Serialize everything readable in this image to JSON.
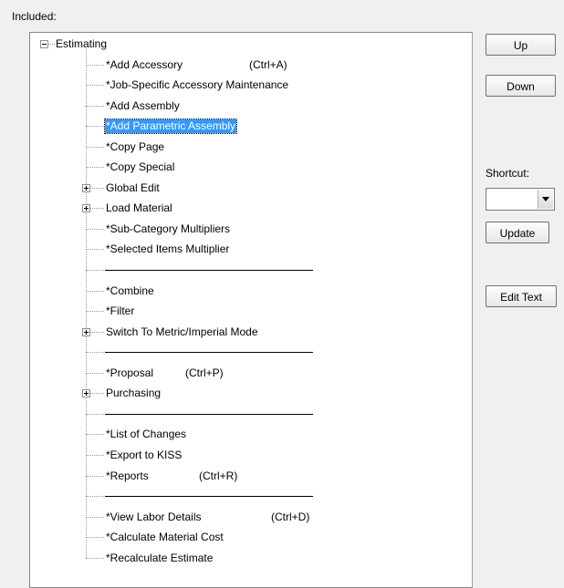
{
  "labels": {
    "included": "Included:",
    "shortcut": "Shortcut:"
  },
  "buttons": {
    "up": "Up",
    "down": "Down",
    "update": "Update",
    "edit_text": "Edit Text"
  },
  "shortcut_combo": {
    "value": ""
  },
  "tree": {
    "root": {
      "label": "Estimating",
      "expanded": true
    },
    "items": [
      {
        "label": "*Add Accessory",
        "shortcut": "(Ctrl+A)",
        "type": "leaf"
      },
      {
        "label": "*Job-Specific Accessory Maintenance",
        "type": "leaf"
      },
      {
        "label": "*Add Assembly",
        "type": "leaf"
      },
      {
        "label": "*Add Parametric Assembly",
        "type": "leaf",
        "selected": true
      },
      {
        "label": "*Copy Page",
        "type": "leaf"
      },
      {
        "label": "*Copy Special",
        "type": "leaf"
      },
      {
        "label": "Global Edit",
        "type": "folder",
        "expanded": false
      },
      {
        "label": "Load Material",
        "type": "folder",
        "expanded": false
      },
      {
        "label": "*Sub-Category Multipliers",
        "type": "leaf"
      },
      {
        "label": "*Selected Items Multiplier",
        "type": "leaf"
      },
      {
        "label": "",
        "type": "separator"
      },
      {
        "label": "*Combine",
        "type": "leaf"
      },
      {
        "label": "*Filter",
        "type": "leaf"
      },
      {
        "label": "Switch To Metric/Imperial Mode",
        "type": "folder",
        "expanded": false
      },
      {
        "label": "",
        "type": "separator"
      },
      {
        "label": "*Proposal",
        "shortcut": "(Ctrl+P)",
        "type": "leaf"
      },
      {
        "label": "Purchasing",
        "type": "folder",
        "expanded": false
      },
      {
        "label": "",
        "type": "separator"
      },
      {
        "label": "*List of Changes",
        "type": "leaf"
      },
      {
        "label": "*Export to KISS",
        "type": "leaf"
      },
      {
        "label": "*Reports",
        "shortcut": "(Ctrl+R)",
        "type": "leaf"
      },
      {
        "label": "",
        "type": "separator"
      },
      {
        "label": "*View Labor Details",
        "shortcut": "(Ctrl+D)",
        "type": "leaf"
      },
      {
        "label": "*Calculate Material Cost",
        "type": "leaf"
      },
      {
        "label": "*Recalculate Estimate",
        "type": "leaf"
      }
    ]
  }
}
